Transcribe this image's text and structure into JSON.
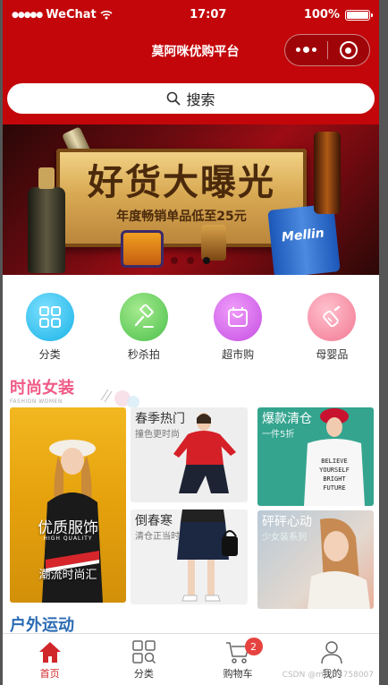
{
  "status_bar": {
    "carrier": "WeChat",
    "time": "17:07",
    "battery": "100%",
    "battery_level": 1.0
  },
  "nav": {
    "title": "莫阿咪优购平台"
  },
  "search": {
    "label": "搜索"
  },
  "banner": {
    "title": "好货大曝光",
    "subtitle": "年度畅销单品低至25元",
    "product_label": "Mellin",
    "dots": 3,
    "active_dot": 2
  },
  "categories": [
    {
      "label": "分类",
      "icon": "grid-icon",
      "color": "#2bc0ea"
    },
    {
      "label": "秒杀拍",
      "icon": "gavel-icon",
      "color": "#5dcb5c"
    },
    {
      "label": "超市购",
      "icon": "shopping-bag-icon",
      "color": "#d05ee8"
    },
    {
      "label": "母婴品",
      "icon": "baby-bottle-icon",
      "color": "#f58aa4"
    }
  ],
  "fashion_section": {
    "title": "时尚女装",
    "subtitle": "FASHION WOMEN",
    "featured": {
      "title": "优质服饰",
      "tag": "HIGH QUALITY",
      "caption": "潮流时尚汇"
    },
    "tiles": [
      {
        "title": "春季热门",
        "sub": "撞色更时尚"
      },
      {
        "title": "倒春寒",
        "sub": "清仓正当时"
      },
      {
        "title": "爆款清仓",
        "sub": "一件5折"
      },
      {
        "title": "砰砰心动",
        "sub": "少女装系列"
      }
    ],
    "shirt_text": "BELIEVE YOURSELF BRIGHT FUTURE"
  },
  "outdoor_section": {
    "title": "户外运动"
  },
  "tabbar": {
    "items": [
      {
        "label": "首页",
        "icon": "home-icon",
        "active": true
      },
      {
        "label": "分类",
        "icon": "category-icon",
        "active": false
      },
      {
        "label": "购物车",
        "icon": "cart-icon",
        "active": false
      },
      {
        "label": "我的",
        "icon": "user-icon",
        "active": false
      }
    ],
    "cart_badge": "2"
  },
  "watermark": "CSDN @m0_63758007"
}
